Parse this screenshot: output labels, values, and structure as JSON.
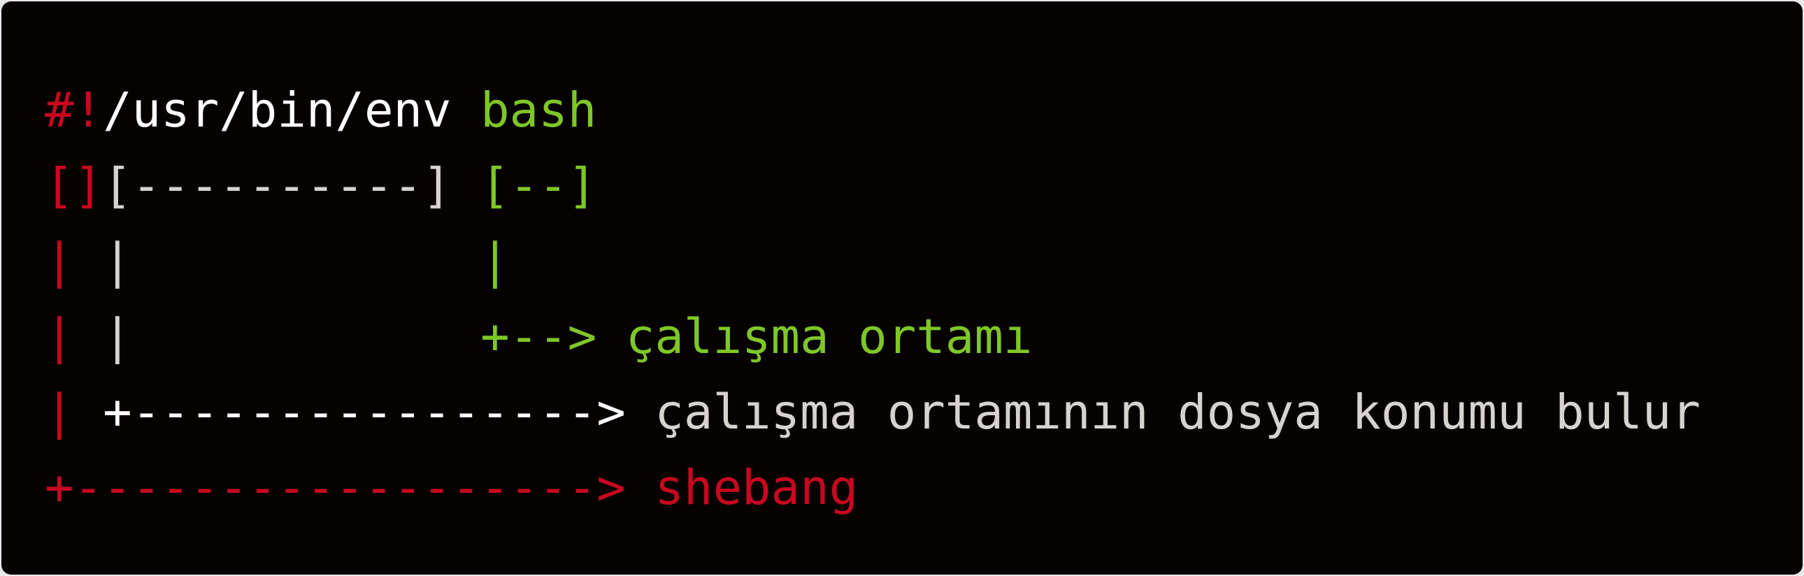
{
  "colors": {
    "background": "#070202",
    "red": "#c8081f",
    "white": "#ffffff",
    "light_gray": "#d8d2ce",
    "green": "#7ec728"
  },
  "lines": [
    [
      {
        "text": "#!",
        "color": "red"
      },
      {
        "text": "/usr/bin/env ",
        "color": "white"
      },
      {
        "text": "bash",
        "color": "green"
      }
    ],
    [
      {
        "text": "[]",
        "color": "red"
      },
      {
        "text": "[----------] ",
        "color": "light_gray"
      },
      {
        "text": "[--]",
        "color": "green"
      }
    ],
    [
      {
        "text": "| ",
        "color": "red"
      },
      {
        "text": "|            ",
        "color": "light_gray"
      },
      {
        "text": "|",
        "color": "green"
      }
    ],
    [
      {
        "text": "| ",
        "color": "red"
      },
      {
        "text": "|            ",
        "color": "light_gray"
      },
      {
        "text": "+--> çalışma ortamı",
        "color": "green"
      }
    ],
    [
      {
        "text": "| ",
        "color": "red"
      },
      {
        "text": "+----------------> ",
        "color": "white"
      },
      {
        "text": "çalışma ortamının dosya konumu bulur",
        "color": "light_gray"
      }
    ],
    [
      {
        "text": "+------------------> shebang",
        "color": "red"
      }
    ]
  ]
}
